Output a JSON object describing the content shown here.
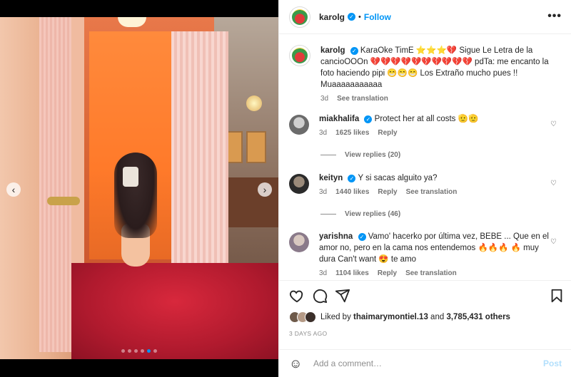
{
  "post": {
    "author": "karolg",
    "follow_label": "Follow",
    "bullet": "•",
    "more_label": "•••",
    "carousel": {
      "prev": "‹",
      "next": "›",
      "dots": 6,
      "active_dot": 5
    }
  },
  "caption": {
    "username": "karolg",
    "text": "KaraOke TimE ⭐⭐⭐💔 Sigue Le Letra de la cancioOOOn 💔💔💔💔💔💔💔💔💔💔 pdTa: me encanto la foto haciendo pipi 😁😁😁 Los Extraño mucho pues !! Muaaaaaaaaaaa",
    "time": "3d",
    "translate": "See translation"
  },
  "comments": [
    {
      "username": "miakhalifa",
      "text": "Protect her at all costs 🫡🫡",
      "time": "3d",
      "likes": "1625 likes",
      "reply": "Reply",
      "translate": "",
      "view_replies": "View replies (20)"
    },
    {
      "username": "keityn",
      "text": "Y si sacas alguito ya?",
      "time": "3d",
      "likes": "1440 likes",
      "reply": "Reply",
      "translate": "See translation",
      "view_replies": "View replies (46)"
    },
    {
      "username": "yarishna",
      "text": "Vamo' hacerko por última vez, BEBE ... Que en el amor no, pero en la cama nos entendemos 🔥🔥🔥 🔥 muy dura Can't want 😍 te amo",
      "time": "3d",
      "likes": "1104 likes",
      "reply": "Reply",
      "translate": "See translation",
      "view_replies": ""
    }
  ],
  "likes": {
    "prefix": "Liked by ",
    "user": "thaimarymontiel.13",
    "mid": " and ",
    "count": "3,785,431 others"
  },
  "date": "3 DAYS AGO",
  "add_comment": {
    "placeholder": "Add a comment…",
    "post_label": "Post",
    "emoji": "☺"
  },
  "icons": [
    "heart-icon",
    "comment-icon",
    "share-icon",
    "bookmark-icon",
    "verified-icon",
    "more-icon",
    "emoji-icon"
  ],
  "colors": {
    "accent": "#0095f6",
    "muted": "#737373",
    "post_disabled": "#b2dffc"
  }
}
